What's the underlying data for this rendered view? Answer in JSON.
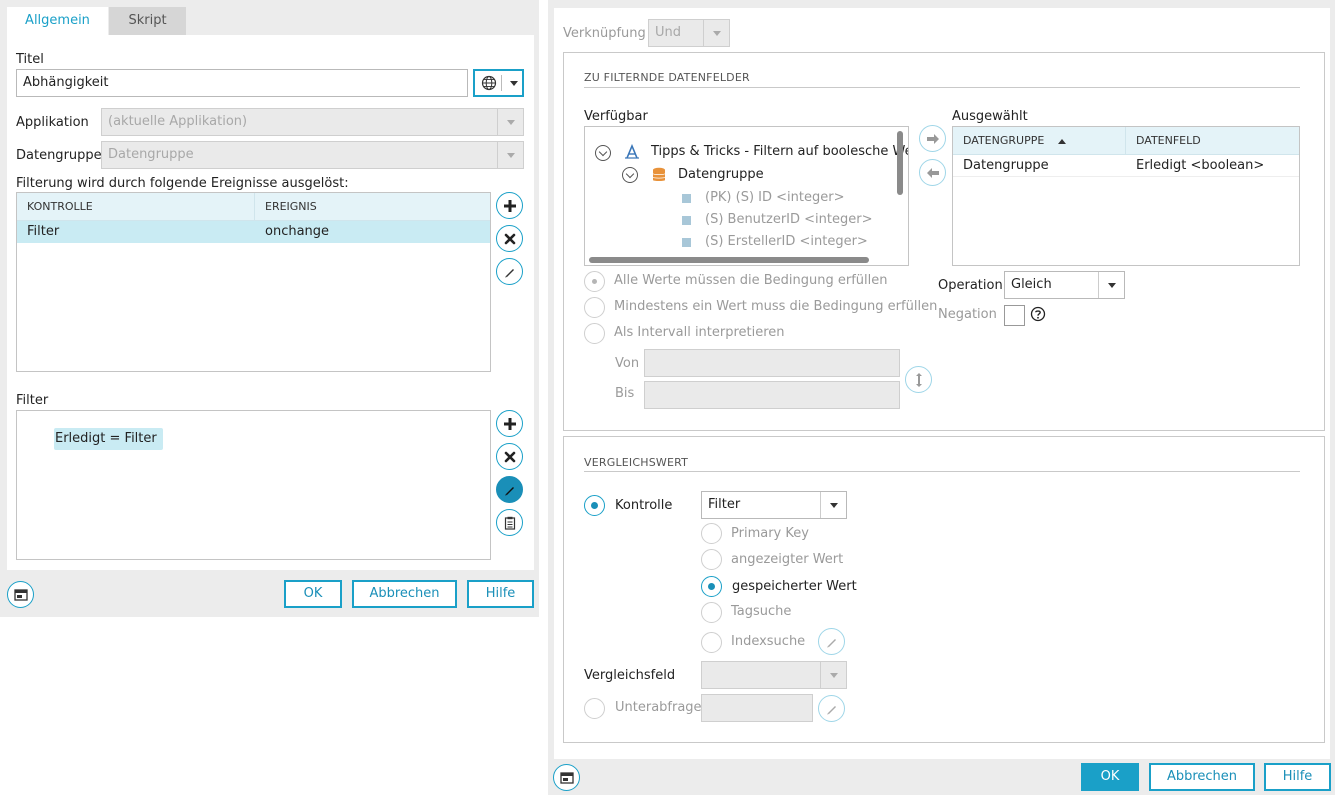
{
  "left": {
    "tabs": [
      {
        "label": "Allgemein"
      },
      {
        "label": "Skript"
      }
    ],
    "titel_label": "Titel",
    "titel_value": "Abhängigkeit",
    "applikation_label": "Applikation",
    "applikation_value": "(aktuelle Applikation)",
    "datengruppe_label": "Datengruppe",
    "datengruppe_value": "Datengruppe",
    "events_label": "Filterung wird durch folgende Ereignisse ausgelöst:",
    "events_table": {
      "headers": [
        "KONTROLLE",
        "EREIGNIS"
      ],
      "rows": [
        {
          "kontrolle": "Filter",
          "ereignis": "onchange"
        }
      ]
    },
    "filter_label": "Filter",
    "filter_expression": "Erledigt = Filter",
    "buttons": {
      "ok": "OK",
      "cancel": "Abbrechen",
      "help": "Hilfe"
    }
  },
  "right": {
    "verknuepfung_label": "Verknüpfung",
    "verknuepfung_value": "Und",
    "section1_title": "ZU FILTERNDE DATENFELDER",
    "verfuegbar_label": "Verfügbar",
    "tree": {
      "root": "Tipps & Tricks - Filtern auf boolesche Wer",
      "group": "Datengruppe",
      "fields": [
        "(PK) (S) ID <integer>",
        "(S) BenutzerID <integer>",
        "(S) ErstellerID <integer>"
      ]
    },
    "ausgewaehlt_label": "Ausgewählt",
    "selected_table": {
      "headers": [
        "DATENGRUPPE",
        "DATENFELD"
      ],
      "rows": [
        {
          "datengruppe": "Datengruppe",
          "datenfeld": "Erledigt <boolean>"
        }
      ]
    },
    "match_options": [
      "Alle Werte müssen die Bedingung erfüllen",
      "Mindestens ein Wert muss die Bedingung erfüllen",
      "Als Intervall interpretieren"
    ],
    "von_label": "Von",
    "bis_label": "Bis",
    "operation_label": "Operation",
    "operation_value": "Gleich",
    "negation_label": "Negation",
    "section2_title": "VERGLEICHSWERT",
    "kontrolle_label": "Kontrolle",
    "kontrolle_value": "Filter",
    "value_options": [
      "Primary Key",
      "angezeigter Wert",
      "gespeicherter Wert",
      "Tagsuche",
      "Indexsuche"
    ],
    "vergleichsfeld_label": "Vergleichsfeld",
    "unterabfrage_label": "Unterabfrage",
    "buttons": {
      "ok": "OK",
      "cancel": "Abbrechen",
      "help": "Hilfe"
    }
  },
  "colors": {
    "accent": "#1aa0c8",
    "selection": "#c9ebf3",
    "header": "#e4f3f8"
  }
}
